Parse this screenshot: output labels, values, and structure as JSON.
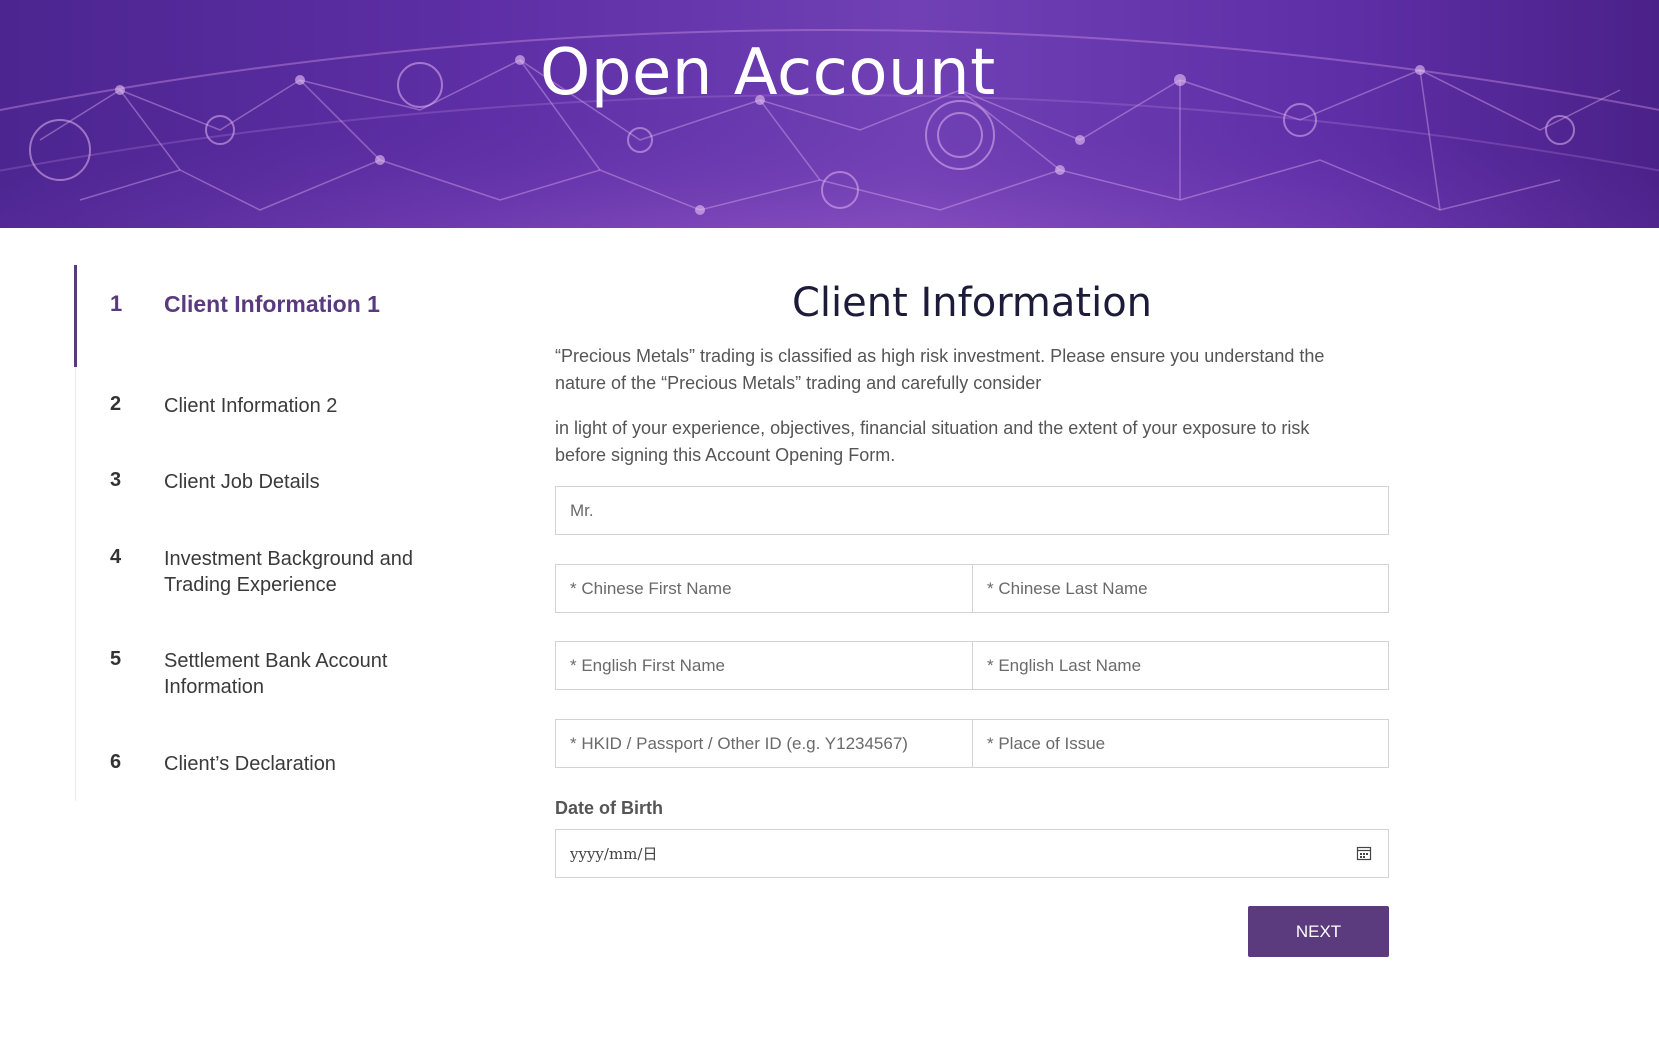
{
  "hero": {
    "title": "Open Account"
  },
  "steps": [
    {
      "num": "1",
      "label": "Client Information 1"
    },
    {
      "num": "2",
      "label": "Client Information 2"
    },
    {
      "num": "3",
      "label": "Client Job Details"
    },
    {
      "num": "4",
      "label": "Investment Background and Trading Experience"
    },
    {
      "num": "5",
      "label": "Settlement Bank Account Information"
    },
    {
      "num": "6",
      "label": "Client’s Declaration"
    }
  ],
  "form": {
    "title": "Client Information",
    "intro_1": "“Precious Metals” trading is classified as high risk investment. Please ensure you understand the nature of the “Precious Metals” trading and carefully consider",
    "intro_2": "in light of your experience, objectives, financial situation and the extent of your exposure to risk before signing this Account Opening Form.",
    "salutation": "Mr.",
    "chinese_first_name": "* Chinese First Name",
    "chinese_last_name": "* Chinese Last Name",
    "english_first_name": "* English First Name",
    "english_last_name": "* English Last Name",
    "id_number": "* HKID / Passport / Other ID (e.g. Y1234567)",
    "place_of_issue": "* Place of Issue",
    "dob_label": "Date of Birth",
    "dob_placeholder": "yyyy/mm/日",
    "next_label": "NEXT"
  },
  "colors": {
    "accent": "#5b3a7d",
    "banner": "#5e2fa6",
    "text": "#555555"
  }
}
